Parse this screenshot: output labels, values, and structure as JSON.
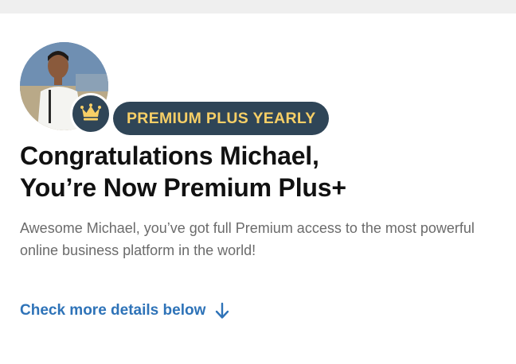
{
  "plan_badge": {
    "label": "PREMIUM PLUS YEARLY"
  },
  "headline": {
    "line1": "Congratulations Michael,",
    "line2": "You’re Now Premium Plus+"
  },
  "subtext": "Awesome Michael, you’ve got full Premium access to the most powerful online business platform in the world!",
  "details_link": {
    "label": "Check more details below",
    "icon": "arrow-down-icon"
  },
  "icons": {
    "crown": "crown-icon"
  },
  "colors": {
    "badge_bg": "#2f4557",
    "badge_text": "#f7cf66",
    "link": "#2e73b8",
    "headline": "#111111",
    "subtext": "#6b6b6b"
  }
}
